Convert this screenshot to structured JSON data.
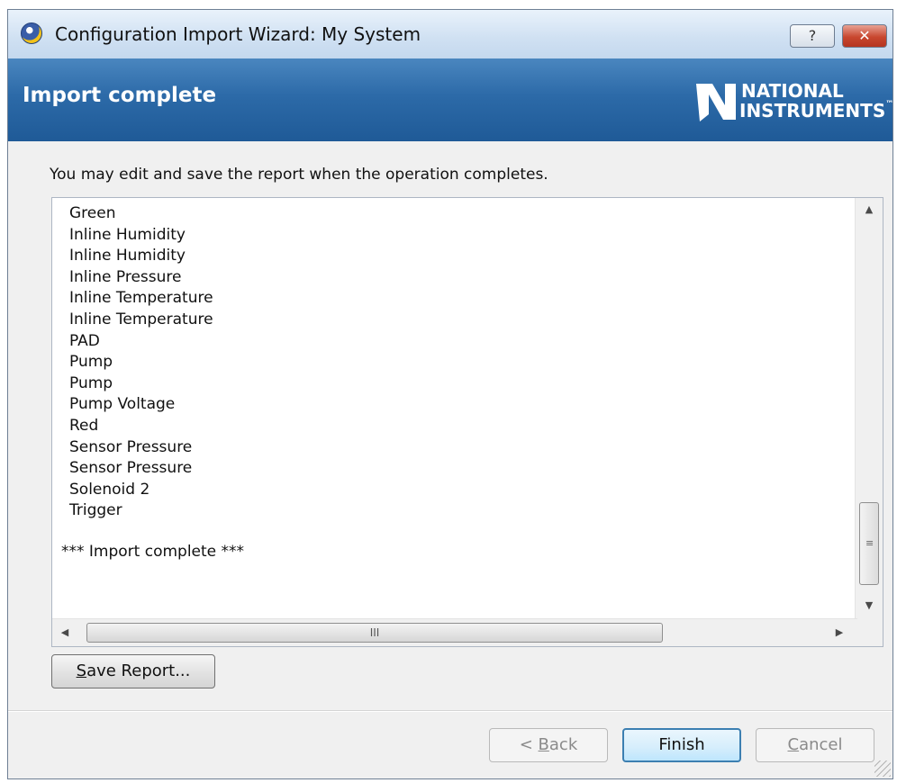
{
  "window": {
    "title": "Configuration Import Wizard: My System",
    "help_glyph": "?",
    "close_glyph": "✕"
  },
  "banner": {
    "title": "Import complete",
    "logo_line1": "NATIONAL",
    "logo_line2": "INSTRUMENTS",
    "logo_mark": "™"
  },
  "instruction": "You may edit and save the report when the operation completes.",
  "report": {
    "lines": [
      "Green",
      "Inline Humidity",
      "Inline Humidity",
      "Inline Pressure",
      "Inline Temperature",
      "Inline Temperature",
      "PAD",
      "Pump",
      "Pump",
      "Pump Voltage",
      "Red",
      "Sensor Pressure",
      "Sensor Pressure",
      "Solenoid 2",
      "Trigger"
    ],
    "status": "*** Import complete ***",
    "scroll_up": "▲",
    "scroll_down": "▼",
    "scroll_left": "◀",
    "scroll_right": "▶",
    "vthumb_grip": "≡",
    "hthumb_grip": "III"
  },
  "buttons": {
    "save_mnemonic": "S",
    "save_rest": "ave Report...",
    "back_prefix": "< ",
    "back_mnemonic": "B",
    "back_rest": "ack",
    "finish": "Finish",
    "cancel_mnemonic": "C",
    "cancel_rest": "ancel"
  },
  "icons": {
    "app": "ni-wizard-icon",
    "logo": "national-instruments-eagle-logo"
  }
}
